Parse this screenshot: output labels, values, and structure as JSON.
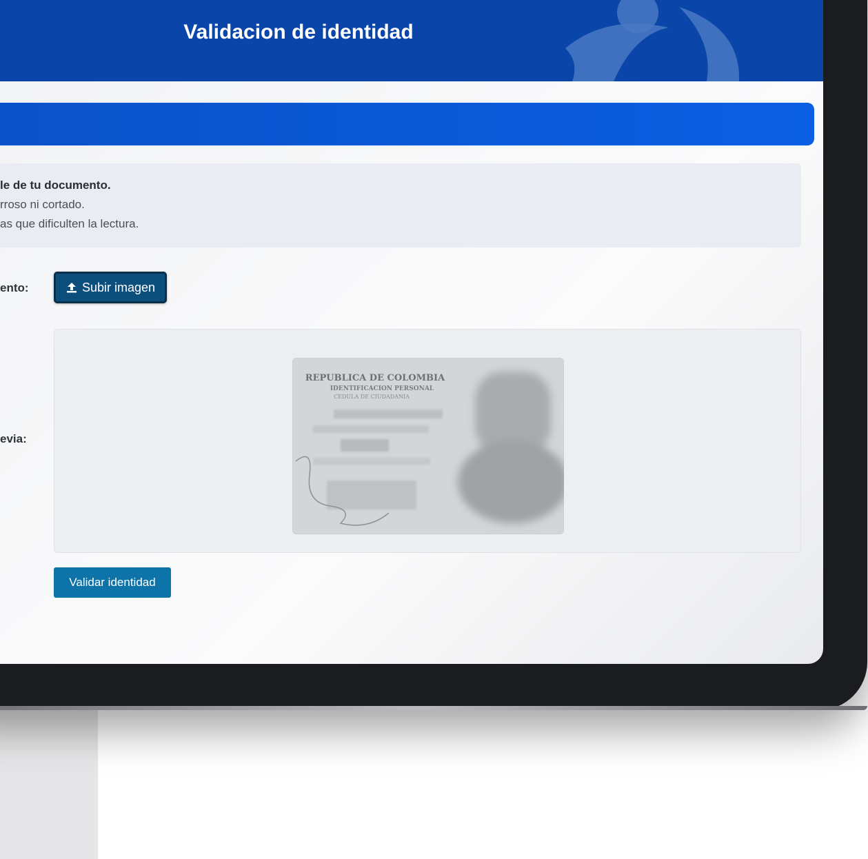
{
  "header": {
    "title": "Validacion de identidad"
  },
  "instructions": {
    "line1": "le de tu documento.",
    "line2": "rroso ni cortado.",
    "line3": "as que dificulten la lectura."
  },
  "form": {
    "document_label": "ento:",
    "upload_button_label": "Subir imagen",
    "preview_label": "evia:",
    "validate_button_label": "Validar identidad"
  },
  "id_card": {
    "line1": "REPUBLICA DE COLOMBIA",
    "line2": "IDENTIFICACION PERSONAL",
    "line3": "CEDULA DE CIUDADANIA"
  },
  "colors": {
    "header_blue": "#0a45a9",
    "bar_blue": "#0b5fe3",
    "upload_button": "#0d4f7c",
    "validate_button": "#0e73a8"
  },
  "icons": [
    "upload-icon",
    "brand-logo-icon"
  ]
}
